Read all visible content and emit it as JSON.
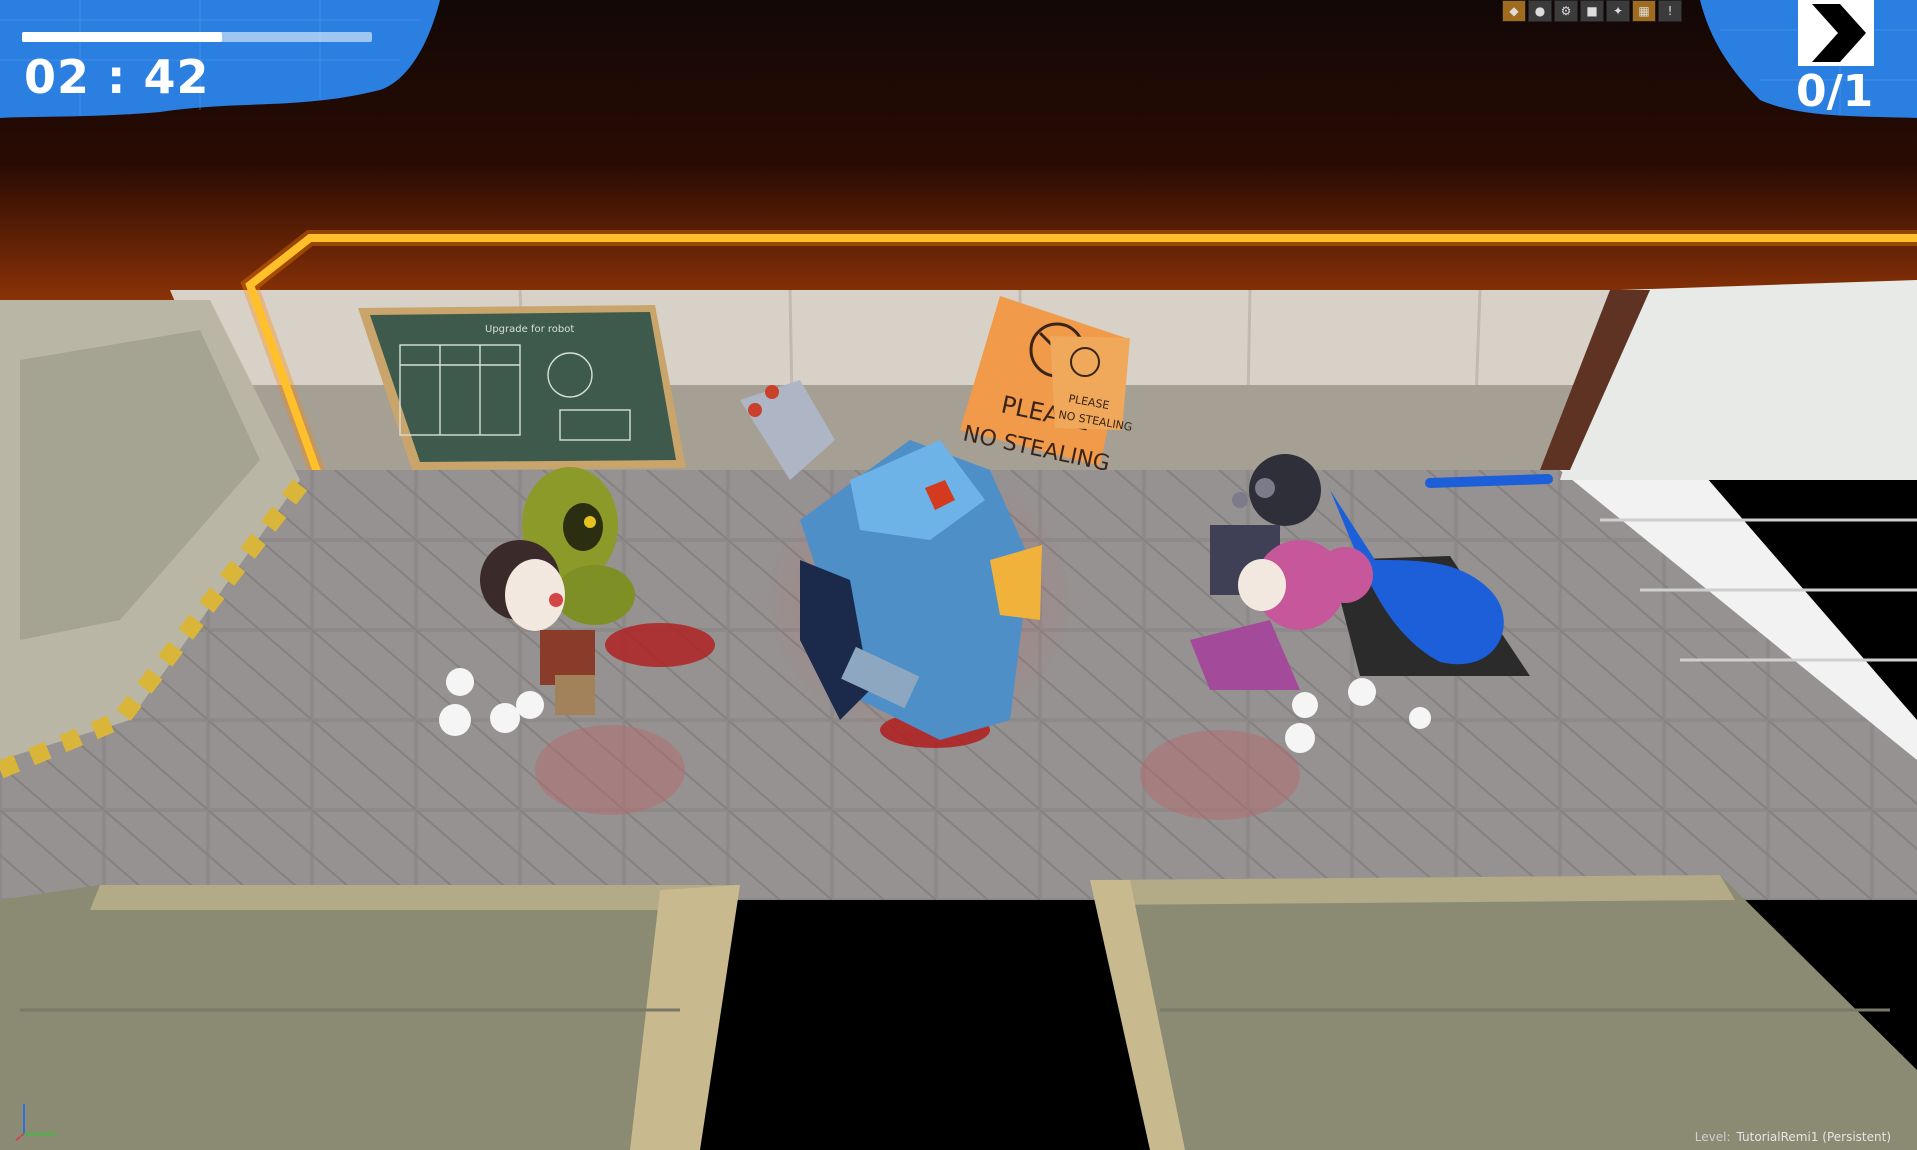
{
  "hud": {
    "timer": "02 : 42",
    "objective_count": "0/1",
    "progress_fraction": 0.57
  },
  "editor": {
    "toolbar_icons": [
      "toolbar-icon",
      "toolbar-icon",
      "toolbar-icon",
      "toolbar-icon",
      "toolbar-icon",
      "toolbar-icon",
      "toolbar-icon"
    ],
    "level_label": "Level:",
    "level_name": "TutorialRemi1 (Persistent)"
  },
  "scene": {
    "sign_line1": "PLEASE",
    "sign_line2": "NO STEALING",
    "small_sign_line1": "PLEASE",
    "small_sign_line2": "NO STEALING",
    "chalkboard_title": "Upgrade for robot"
  },
  "colors": {
    "hud_blue": "#2a7fe0",
    "neon_orange": "#ffb21a",
    "sign_orange": "#f08a3a",
    "floor": "#8f8b8b",
    "paint_blue": "#1c5fd9"
  }
}
